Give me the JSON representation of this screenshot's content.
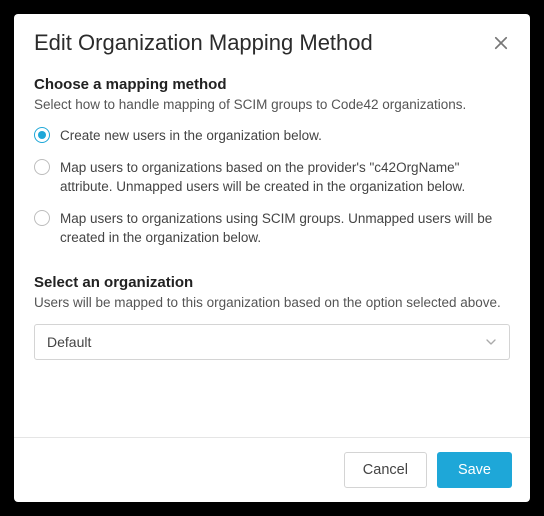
{
  "dialog": {
    "title": "Edit Organization Mapping Method"
  },
  "mapping": {
    "heading": "Choose a mapping method",
    "description": "Select how to handle mapping of SCIM groups to Code42 organizations.",
    "options": [
      "Create new users in the organization below.",
      "Map users to organizations based on the provider's \"c42OrgName\" attribute. Unmapped users will be created in the organization below.",
      "Map users to organizations using SCIM groups. Unmapped users will be created in the organization below."
    ],
    "selectedIndex": 0
  },
  "org": {
    "heading": "Select an organization",
    "description": "Users will be mapped to this organization based on the option selected above.",
    "value": "Default"
  },
  "footer": {
    "cancel": "Cancel",
    "save": "Save"
  }
}
